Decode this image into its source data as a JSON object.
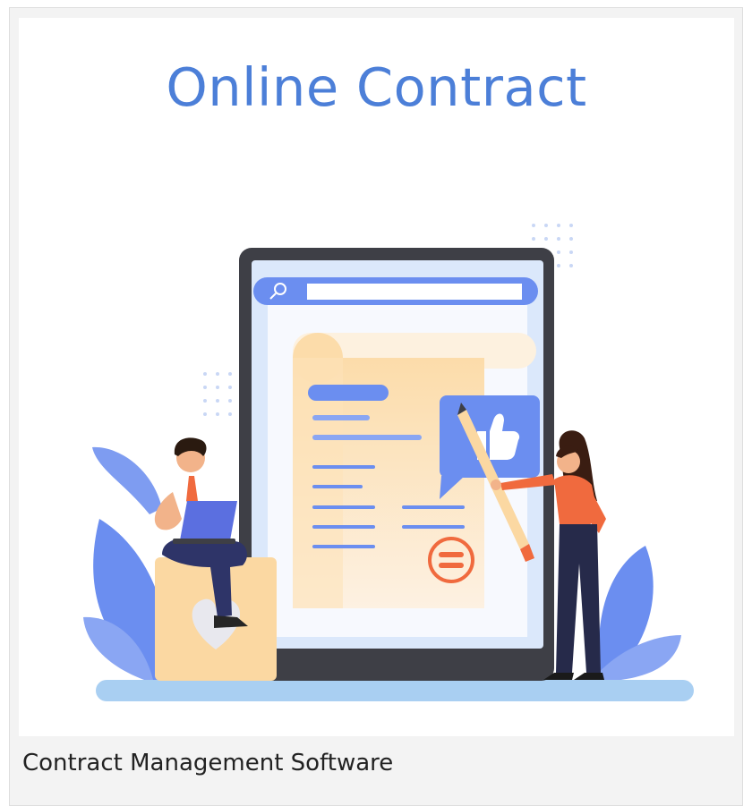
{
  "image": {
    "title": "Online Contract",
    "caption": "Contract Management Software",
    "colors": {
      "title": "#4c7fd8",
      "accent_blue": "#6b8ef0",
      "accent_orange": "#f06a3e",
      "cream": "#fbd8a2",
      "device_frame": "#3e3f46",
      "floor": "#a9cff2"
    }
  }
}
